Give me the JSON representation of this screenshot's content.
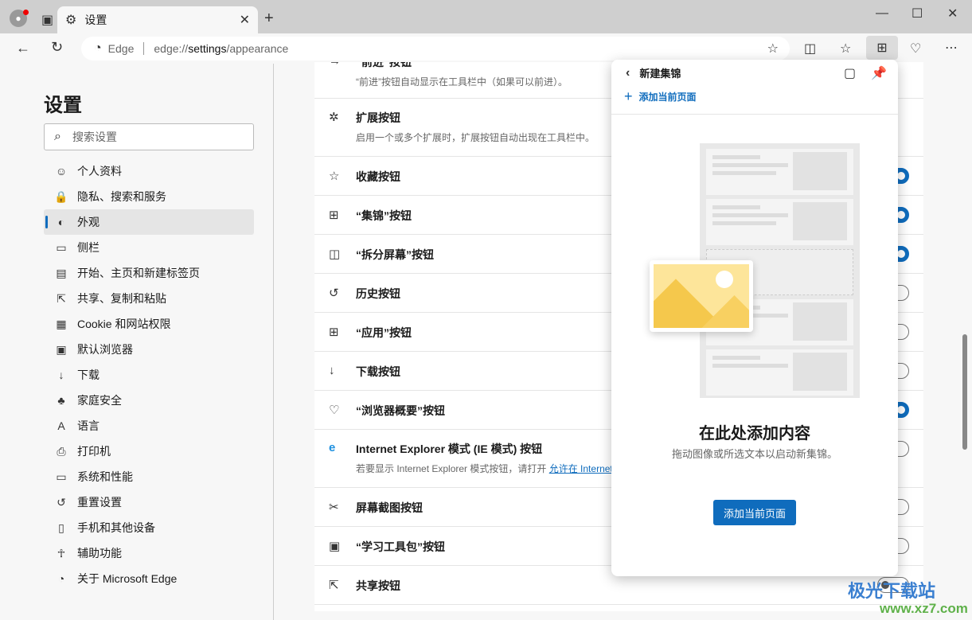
{
  "browser": {
    "tab_title": "设置",
    "address_brand": "Edge",
    "url_prefix": "edge://",
    "url_main": "settings",
    "url_suffix": "/appearance"
  },
  "sidebar": {
    "title": "设置",
    "search_placeholder": "搜索设置",
    "items": [
      {
        "label": "个人资料",
        "icon": "profile-icon"
      },
      {
        "label": "隐私、搜索和服务",
        "icon": "lock-icon"
      },
      {
        "label": "外观",
        "icon": "palette-icon",
        "selected": true
      },
      {
        "label": "侧栏",
        "icon": "sidebar-icon"
      },
      {
        "label": "开始、主页和新建标签页",
        "icon": "home-icon"
      },
      {
        "label": "共享、复制和粘贴",
        "icon": "share-icon"
      },
      {
        "label": "Cookie 和网站权限",
        "icon": "cookie-icon"
      },
      {
        "label": "默认浏览器",
        "icon": "browser-icon"
      },
      {
        "label": "下载",
        "icon": "download-icon"
      },
      {
        "label": "家庭安全",
        "icon": "family-icon"
      },
      {
        "label": "语言",
        "icon": "language-icon"
      },
      {
        "label": "打印机",
        "icon": "printer-icon"
      },
      {
        "label": "系统和性能",
        "icon": "system-icon"
      },
      {
        "label": "重置设置",
        "icon": "reset-icon"
      },
      {
        "label": "手机和其他设备",
        "icon": "phone-icon"
      },
      {
        "label": "辅助功能",
        "icon": "accessibility-icon"
      },
      {
        "label": "关于 Microsoft Edge",
        "icon": "edge-icon"
      }
    ]
  },
  "settings": [
    {
      "label": "“前进”按钮",
      "desc": "“前进”按钮自动显示在工具栏中（如果可以前进）。",
      "toggle": null
    },
    {
      "label": "扩展按钮",
      "desc": "启用一个或多个扩展时，扩展按钮自动出现在工具栏中。",
      "toggle": null
    },
    {
      "label": "收藏按钮",
      "toggle": true
    },
    {
      "label": "“集锦”按钮",
      "toggle": true
    },
    {
      "label": "“拆分屏幕”按钮",
      "toggle": true
    },
    {
      "label": "历史按钮",
      "toggle": false
    },
    {
      "label": "“应用”按钮",
      "toggle": false
    },
    {
      "label": "下载按钮",
      "toggle": false
    },
    {
      "label": "“浏览器概要”按钮",
      "toggle": true
    },
    {
      "label": "Internet Explorer 模式 (IE 模式) 按钮",
      "desc": "若要显示 Internet Explorer 模式按钮，请打开 ",
      "link": "允许在 Internet",
      "toggle": false
    },
    {
      "label": "屏幕截图按钮",
      "toggle": false
    },
    {
      "label": "“学习工具包”按钮",
      "toggle": false
    },
    {
      "label": "共享按钮",
      "toggle": false
    }
  ],
  "collections": {
    "title": "新建集锦",
    "add_link": "添加当前页面",
    "empty_title": "在此处添加内容",
    "empty_desc": "拖动图像或所选文本以启动新集锦。",
    "add_button": "添加当前页面"
  },
  "watermark": {
    "name": "极光下载站",
    "url": "www.xz7.com"
  },
  "colors": {
    "accent": "#0f6cbd"
  }
}
